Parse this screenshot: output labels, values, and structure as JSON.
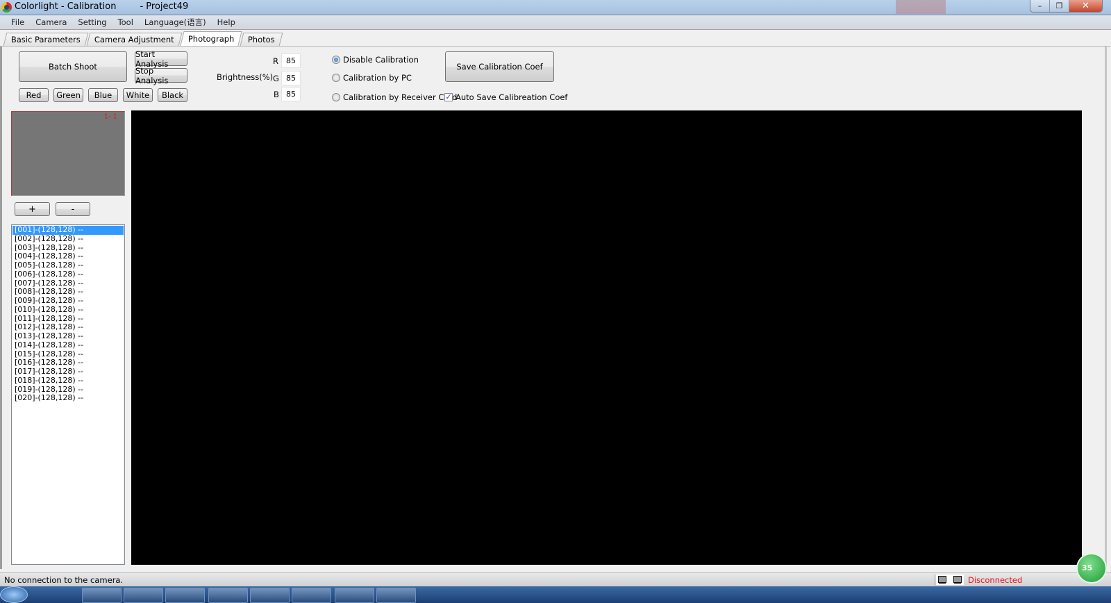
{
  "window": {
    "title": "Colorlight - Calibration",
    "project": "- Project49",
    "controls": {
      "minimize": "–",
      "restore": "❐",
      "close": "✕"
    }
  },
  "menu": [
    "File",
    "Camera",
    "Setting",
    "Tool",
    "Language(语言)",
    "Help"
  ],
  "tabs": [
    {
      "label": "Basic Parameters",
      "active": false
    },
    {
      "label": "Camera Adjustment",
      "active": false
    },
    {
      "label": "Photograph",
      "active": true
    },
    {
      "label": "Photos",
      "active": false
    }
  ],
  "toolbar": {
    "batch_shoot": "Batch Shoot",
    "start_analysis": "Start Analysis",
    "stop_analysis": "Stop Analysis",
    "colors": [
      "Red",
      "Green",
      "Blue",
      "White",
      "Black"
    ],
    "brightness_label": "Brightness(%)",
    "brightness": {
      "R_label": "R",
      "R": "85",
      "G_label": "G",
      "G": "85",
      "B_label": "B",
      "B": "85"
    },
    "calibration_options": [
      {
        "label": "Disable Calibration",
        "selected": true
      },
      {
        "label": "Calibration by PC",
        "selected": false
      },
      {
        "label": "Calibration by Receiver Card",
        "selected": false
      }
    ],
    "save_coef": "Save Calibration Coef",
    "auto_save": {
      "label": "Auto Save Calibreation Coef",
      "checked": true,
      "check_glyph": "✓"
    }
  },
  "preview": {
    "position_label": "1- 1"
  },
  "zoom_buttons": {
    "plus": "+",
    "minus": "-"
  },
  "list": {
    "selected_index": 0,
    "items": [
      "[001]-(128,128) --",
      "[002]-(128,128) --",
      "[003]-(128,128) --",
      "[004]-(128,128) --",
      "[005]-(128,128) --",
      "[006]-(128,128) --",
      "[007]-(128,128) --",
      "[008]-(128,128) --",
      "[009]-(128,128) --",
      "[010]-(128,128) --",
      "[011]-(128,128) --",
      "[012]-(128,128) --",
      "[013]-(128,128) --",
      "[014]-(128,128) --",
      "[015]-(128,128) --",
      "[016]-(128,128) --",
      "[017]-(128,128) --",
      "[018]-(128,128) --",
      "[019]-(128,128) --",
      "[020]-(128,128) --"
    ]
  },
  "status": {
    "message": "No connection to the camera.",
    "connection": "Disconnected",
    "connection_color": "#ee1111"
  },
  "overlay_badge": "35"
}
